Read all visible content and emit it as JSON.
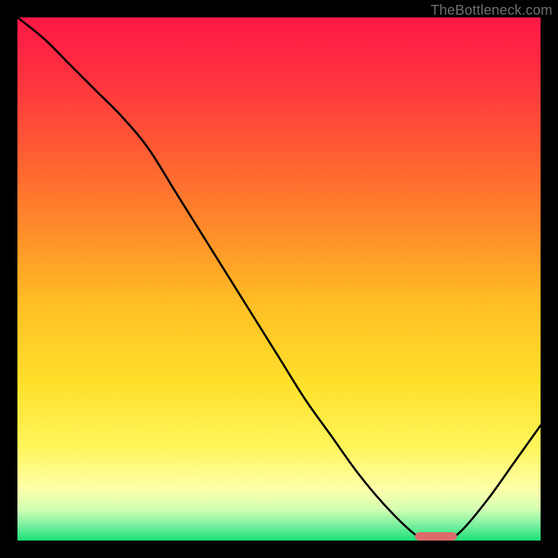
{
  "watermark": "TheBottleneck.com",
  "colors": {
    "top": "#ff1846",
    "orange": "#ff8a2a",
    "yellow": "#ffe02a",
    "paleyellow": "#ffff8a",
    "green": "#1be077",
    "marker": "#dd6b6b",
    "curve": "#000000",
    "background": "#000000"
  },
  "chart_data": {
    "type": "line",
    "title": "",
    "xlabel": "",
    "ylabel": "",
    "xlim": [
      0,
      100
    ],
    "ylim": [
      0,
      100
    ],
    "grid": false,
    "legend": false,
    "note": "V-shaped bottleneck curve on a red→yellow→green vertical gradient background. Minimum (≈0) is near x≈80. A red pill-shaped marker sits along the baseline at the minimum region.",
    "series": [
      {
        "name": "bottleneck-curve",
        "x": [
          0,
          5,
          10,
          15,
          20,
          25,
          30,
          35,
          40,
          45,
          50,
          55,
          60,
          65,
          70,
          75,
          78,
          80,
          82,
          85,
          90,
          95,
          100
        ],
        "values": [
          100,
          96,
          91,
          86,
          81,
          75,
          67,
          59,
          51,
          43,
          35,
          27,
          20,
          13,
          7,
          2,
          0,
          0,
          0,
          2,
          8,
          15,
          22
        ]
      }
    ],
    "marker_band": {
      "x_start": 76,
      "x_end": 84,
      "y": 0
    }
  }
}
